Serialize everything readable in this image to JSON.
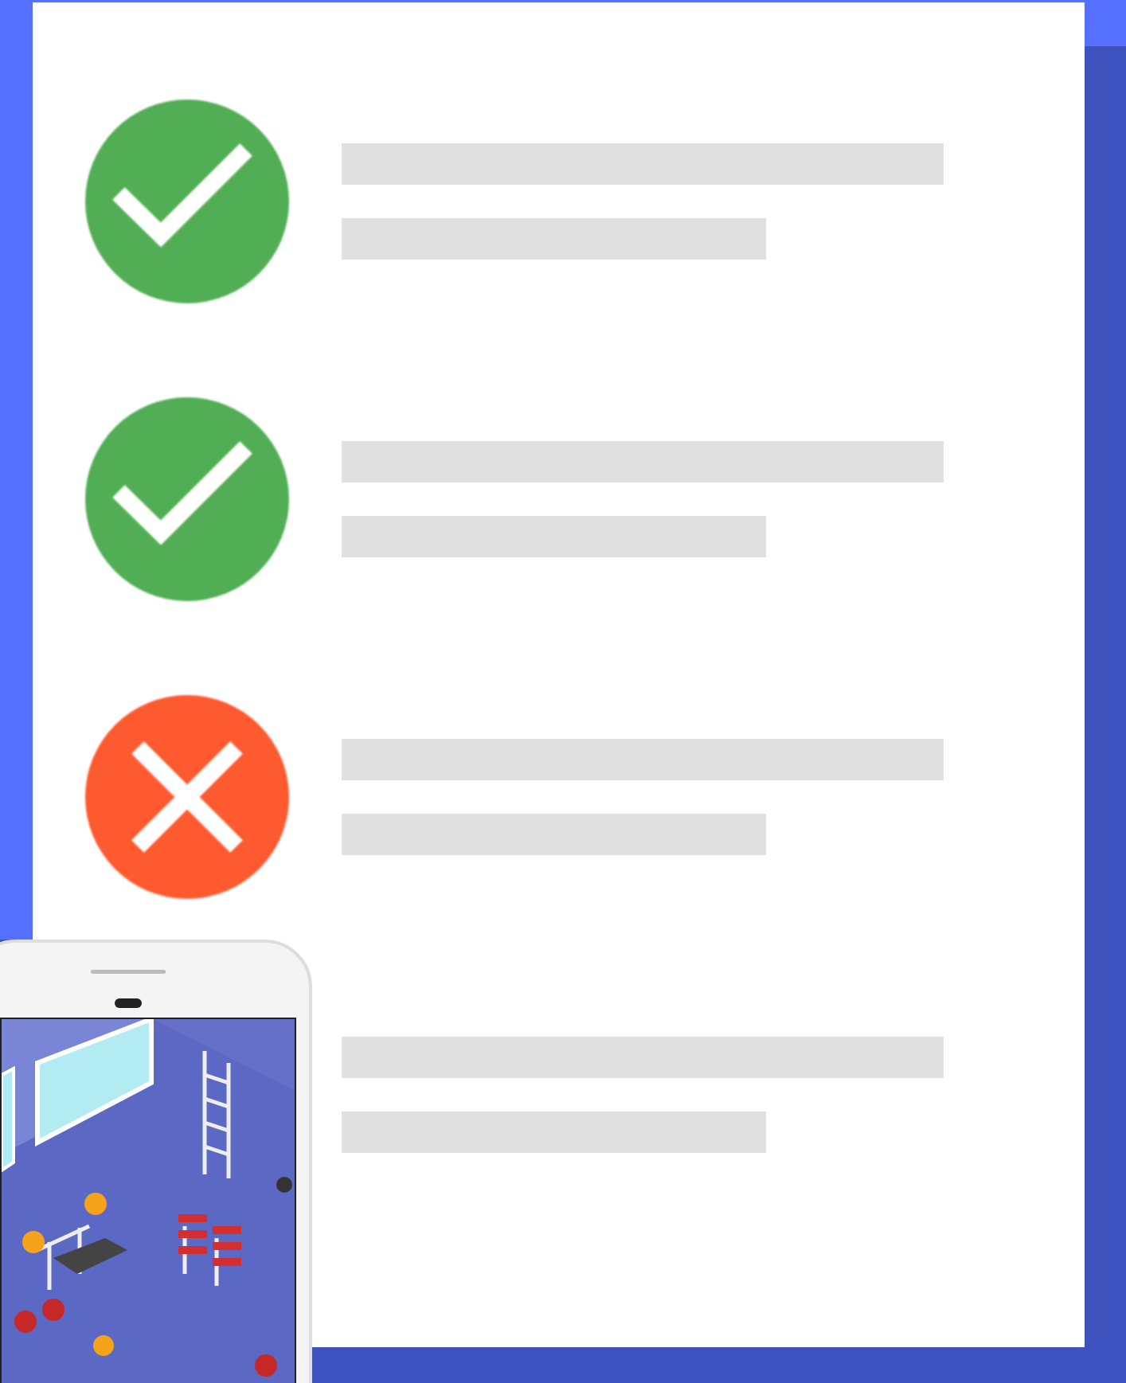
{
  "checklist": [
    {
      "kind": "check"
    },
    {
      "kind": "check"
    },
    {
      "kind": "cross"
    },
    {
      "kind": "none"
    }
  ]
}
